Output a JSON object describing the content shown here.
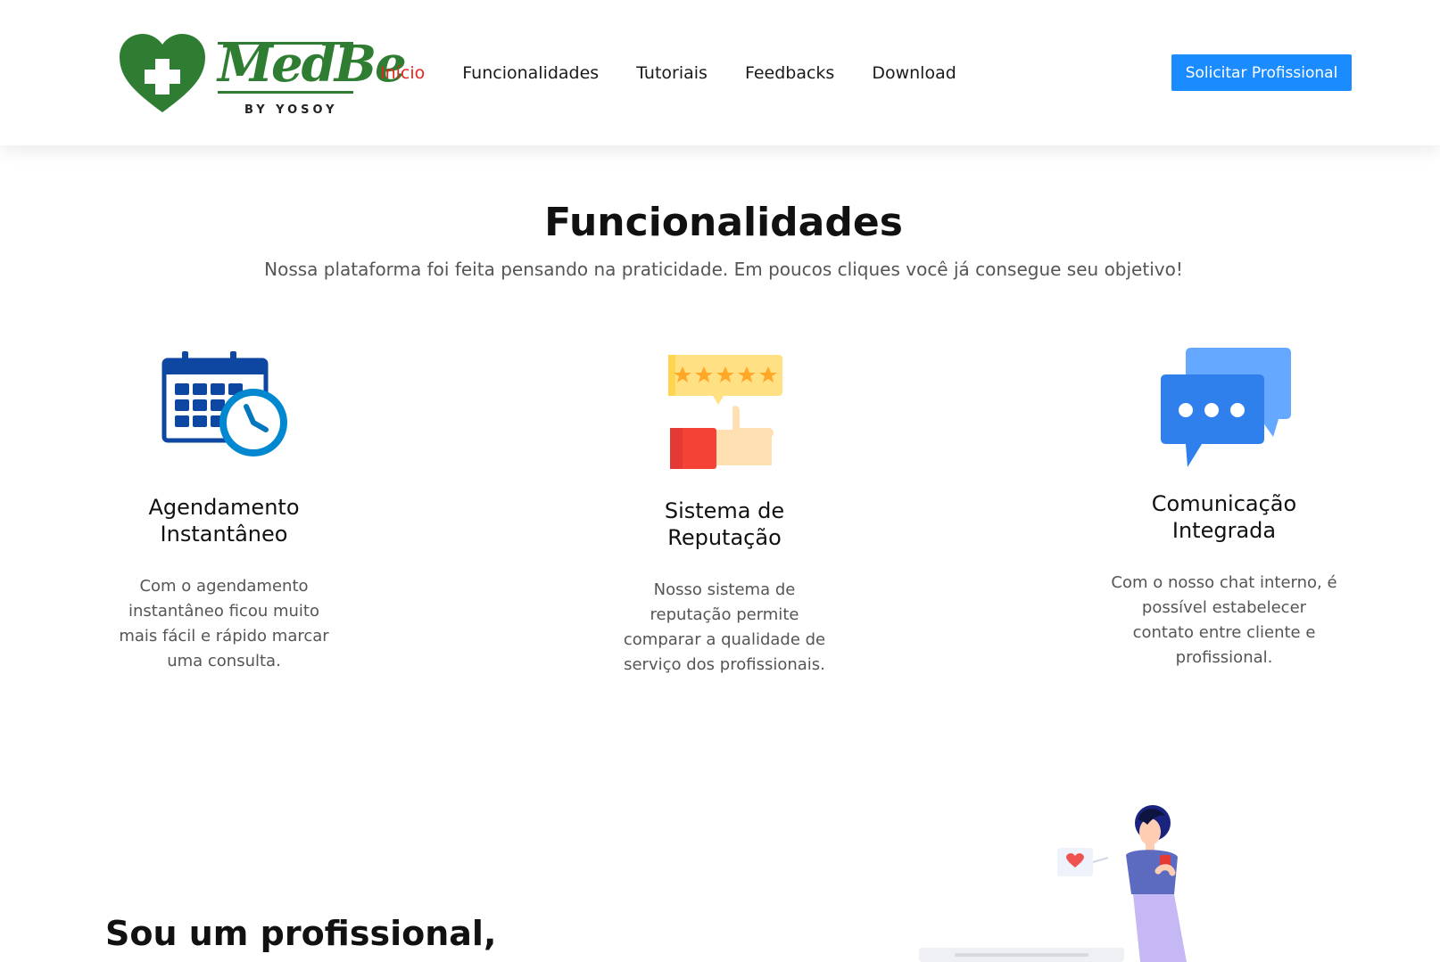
{
  "header": {
    "logo": {
      "name": "MedBe",
      "subtitle": "BY YOSOY"
    },
    "nav": [
      {
        "label": "Início",
        "active": true
      },
      {
        "label": "Funcionalidades",
        "active": false
      },
      {
        "label": "Tutoriais",
        "active": false
      },
      {
        "label": "Feedbacks",
        "active": false
      },
      {
        "label": "Download",
        "active": false
      }
    ],
    "cta_label": "Solicitar Profissional"
  },
  "features_section": {
    "title": "Funcionalidades",
    "subtitle": "Nossa plataforma foi feita pensando na praticidade. Em poucos cliques você já consegue seu objetivo!",
    "items": [
      {
        "icon": "calendar-clock-icon",
        "title_line1": "Agendamento",
        "title_line2": "Instantâneo",
        "desc_lines": [
          "Com o agendamento",
          "instantâneo ficou muito",
          "mais fácil e rápido marcar",
          "uma consulta."
        ]
      },
      {
        "icon": "rating-thumbs-up-icon",
        "title_line1": "Sistema de",
        "title_line2": "Reputação",
        "desc_lines": [
          "Nosso sistema de",
          "reputação permite",
          "comparar a qualidade de",
          "serviço dos profissionais."
        ]
      },
      {
        "icon": "chat-bubbles-icon",
        "title_line1": "Comunicação",
        "title_line2": "Integrada",
        "desc_lines": [
          "Com o nosso chat interno, é",
          "possível estabelecer",
          "contato entre cliente e",
          "profissional."
        ]
      }
    ]
  },
  "next_section": {
    "title": "Sou um profissional,"
  },
  "colors": {
    "brand_green": "#2e7d32",
    "active_nav": "#e3261c",
    "cta_blue": "#1a8cff"
  }
}
